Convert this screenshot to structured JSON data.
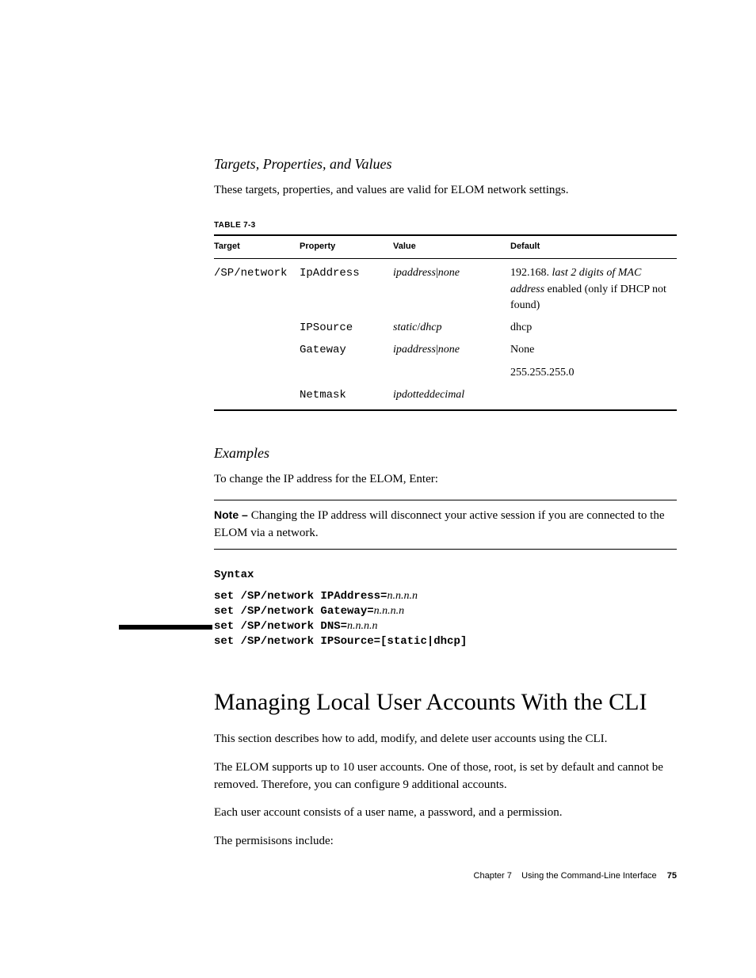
{
  "headings": {
    "tpv": "Targets, Properties, and Values",
    "examples": "Examples",
    "section": "Managing Local User Accounts With the CLI"
  },
  "paragraphs": {
    "tpv_intro": "These targets, properties, and values are valid for ELOM network settings.",
    "examples_intro": "To change the IP address for the ELOM, Enter:",
    "sec_p1": "This section describes how to add, modify, and delete user accounts using the CLI.",
    "sec_p2": "The ELOM supports up to 10 user accounts. One of those, root, is set by default and cannot be removed. Therefore, you can configure 9 additional accounts.",
    "sec_p3": "Each user account consists of a user name, a password, and a permission.",
    "sec_p4": "The permisisons include:"
  },
  "table": {
    "label": "TABLE 7-3",
    "headers": {
      "c1": "Target",
      "c2": "Property",
      "c3": "Value",
      "c4": "Default"
    },
    "rows": {
      "r1": {
        "target": "/SP/network",
        "property": "IpAddress",
        "value_a": "ipaddress",
        "value_sep": "|",
        "value_b": "none",
        "default_a": "192.168. ",
        "default_b_ital": "last 2 digits of MAC address",
        "default_c": " enabled (only if DHCP not found)"
      },
      "r2": {
        "target": "",
        "property": "IPSource",
        "value_a": "static",
        "value_sep": "/",
        "value_b": "dhcp",
        "default": "dhcp"
      },
      "r3": {
        "target": "",
        "property": "Gateway",
        "value_a": "ipaddress",
        "value_sep": "|",
        "value_b": "none",
        "default": "None"
      },
      "r4": {
        "target": "",
        "property": "",
        "value": "",
        "default": "255.255.255.0"
      },
      "r5": {
        "target": "",
        "property": "Netmask",
        "value_ital": "ipdotteddecimal",
        "default": ""
      }
    }
  },
  "note": {
    "label": "Note – ",
    "text": "Changing the IP address will disconnect your active session if you are connected to the ELOM via a network."
  },
  "syntax": {
    "label": "Syntax",
    "lines": {
      "l1a": "set /SP/network IPAddress=",
      "l1b": "n.n.n.n",
      "l2a": "set /SP/network Gateway=",
      "l2b": "n.n.n.n",
      "l3a": "set /SP/network DNS=",
      "l3b": "n.n.n.n",
      "l4": "set /SP/network IPSource=[static|dhcp]"
    }
  },
  "footer": {
    "chapter": "Chapter 7",
    "title": "Using the Command-Line Interface",
    "page": "75"
  }
}
